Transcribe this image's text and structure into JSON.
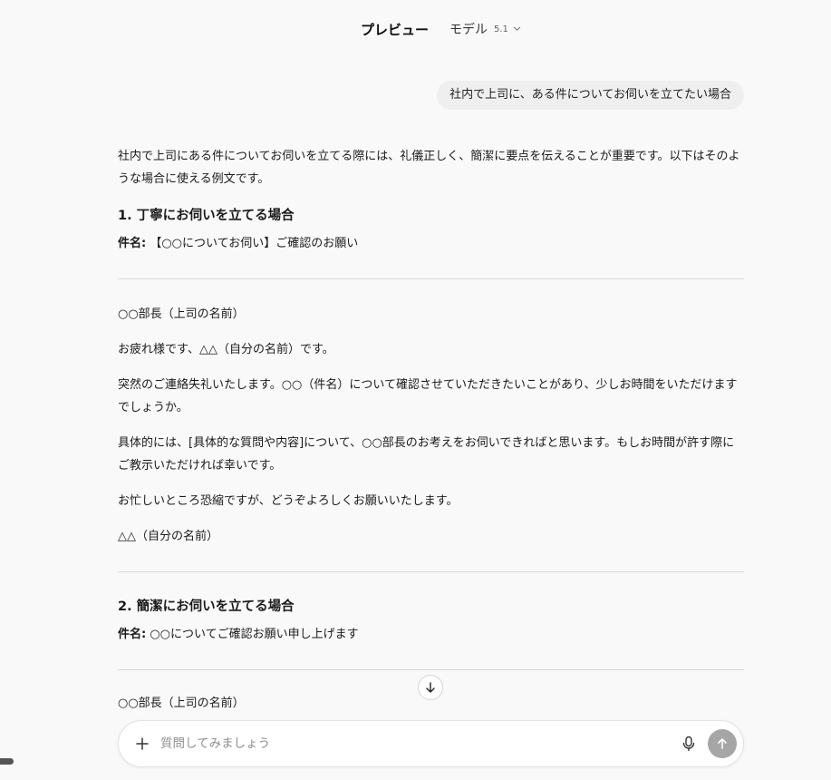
{
  "header": {
    "preview_tab": "プレビュー",
    "model_label": "モデル",
    "model_version": "5.1"
  },
  "user_message": "社内で上司に、ある件についてお伺いを立てたい場合",
  "response": {
    "intro": "社内で上司にある件についてお伺いを立てる際には、礼儀正しく、簡潔に要点を伝えることが重要です。以下はそのような場合に使える例文です。",
    "section1": {
      "heading": "1. 丁寧にお伺いを立てる場合",
      "subject_label": "件名:",
      "subject_text": " 【○○についてお伺い】ご確認のお願い",
      "paragraphs": [
        "○○部長（上司の名前）",
        "お疲れ様です、△△（自分の名前）です。",
        "突然のご連絡失礼いたします。○○（件名）について確認させていただきたいことがあり、少しお時間をいただけますでしょうか。",
        "具体的には、[具体的な質問や内容]について、○○部長のお考えをお伺いできればと思います。もしお時間が許す際にご教示いただければ幸いです。",
        "お忙しいところ恐縮ですが、どうぞよろしくお願いいたします。",
        "△△（自分の名前）"
      ]
    },
    "section2": {
      "heading": "2. 簡潔にお伺いを立てる場合",
      "subject_label": "件名:",
      "subject_text": " ○○についてご確認お願い申し上げます",
      "paragraphs": [
        "○○部長（上司の名前）"
      ]
    }
  },
  "composer": {
    "placeholder": "質問してみましょう"
  },
  "icons": {
    "model_dropdown": "chevron-down-icon",
    "scroll_down": "arrow-down-icon",
    "attach": "plus-icon",
    "voice": "microphone-icon",
    "send": "arrow-up-icon"
  },
  "colors": {
    "background": "#f9f9f9",
    "user_bubble": "#efefef",
    "send_button_disabled": "#a6a6a6",
    "divider": "#d9d9d9"
  }
}
